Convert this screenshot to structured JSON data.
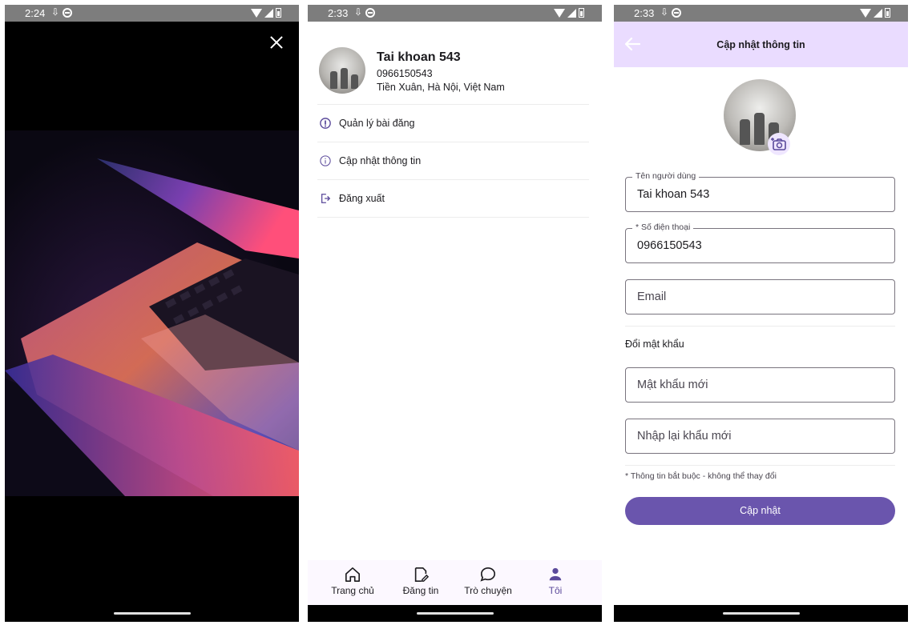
{
  "colors": {
    "accent": "#6a55ad",
    "appbar": "#eadcff",
    "nav_bg": "#fcf8ff",
    "statusbar": "#7d7d7d"
  },
  "panel1": {
    "status_time": "2:24",
    "image_description_icon": "laptop-photo",
    "close_icon": "close-icon"
  },
  "panel2": {
    "status_time": "2:33",
    "profile": {
      "name": "Tai khoan 543",
      "phone": "0966150543",
      "address": "Tiền Xuân, Hà Nội, Việt Nam"
    },
    "menu": [
      {
        "label": "Quản lý bài đăng",
        "icon": "info-filled-icon"
      },
      {
        "label": "Cập nhật thông tin",
        "icon": "info-outline-icon"
      },
      {
        "label": "Đăng xuất",
        "icon": "logout-icon"
      }
    ],
    "tabs": [
      {
        "label": "Trang chủ",
        "icon": "home-icon"
      },
      {
        "label": "Đăng tin",
        "icon": "edit-note-icon"
      },
      {
        "label": "Trò chuyện",
        "icon": "chat-bubble-icon"
      },
      {
        "label": "Tôi",
        "icon": "person-icon",
        "active": true
      }
    ]
  },
  "panel3": {
    "status_time": "2:33",
    "title": "Cập nhật thông tin",
    "fields": {
      "username": {
        "label": "Tên người dùng",
        "value": "Tai khoan 543"
      },
      "phone": {
        "label": "* Số điện thoại",
        "value": "0966150543"
      },
      "email": {
        "placeholder": "Email"
      },
      "new_password": {
        "placeholder": "Mật khẩu mới"
      },
      "confirm_password": {
        "placeholder": "Nhập lại khẩu mới"
      }
    },
    "password_section": "Đổi mật khẩu",
    "required_note": "* Thông tin bắt buộc - không thể thay đổi",
    "submit_label": "Cập nhật"
  }
}
